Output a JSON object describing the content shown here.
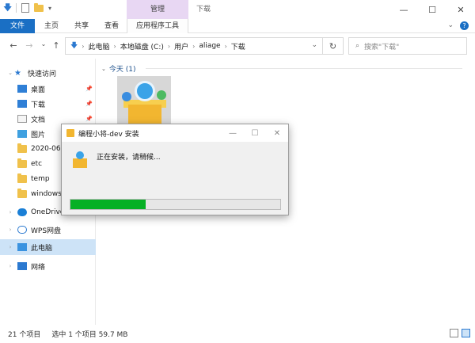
{
  "titlebar": {
    "context_tab": "管理",
    "window_title": "下载",
    "minimize": "—",
    "maximize": "☐",
    "close": "✕"
  },
  "ribbon": {
    "tabs": [
      "文件",
      "主页",
      "共享",
      "查看",
      "应用程序工具"
    ],
    "chevron": "⌄",
    "help": "?"
  },
  "nav": {
    "back": "←",
    "forward": "→",
    "recent": "⌄",
    "up": "↑",
    "breadcrumbs": [
      "此电脑",
      "本地磁盘 (C:)",
      "用户",
      "aliage",
      "下载"
    ],
    "refresh": "↻",
    "search_placeholder": "搜索\"下载\""
  },
  "sidebar": {
    "items": [
      {
        "label": "快速访问",
        "icon": "star-icon"
      },
      {
        "label": "桌面",
        "icon": "desktop-icon",
        "pinned": true
      },
      {
        "label": "下载",
        "icon": "download-icon",
        "pinned": true
      },
      {
        "label": "文档",
        "icon": "document-icon",
        "pinned": true
      },
      {
        "label": "图片",
        "icon": "picture-icon",
        "pinned": true
      },
      {
        "label": "2020-06",
        "icon": "folder-icon"
      },
      {
        "label": "etc",
        "icon": "folder-icon"
      },
      {
        "label": "temp",
        "icon": "folder-icon"
      },
      {
        "label": "windows",
        "icon": "folder-icon"
      },
      {
        "label": "OneDrive",
        "icon": "onedrive-icon"
      },
      {
        "label": "WPS网盘",
        "icon": "wps-cloud-icon"
      },
      {
        "label": "此电脑",
        "icon": "this-pc-icon",
        "selected": true
      },
      {
        "label": "网络",
        "icon": "network-icon"
      }
    ]
  },
  "content": {
    "group_header": "今天 (1)"
  },
  "dialog": {
    "title": "编程小将-dev 安装",
    "status": "正在安装，请稍候...",
    "progress": 0.36
  },
  "statusbar": {
    "item_count": "21 个项目",
    "selection": "选中 1 个项目  59.7 MB"
  },
  "colors": {
    "accent": "#1a6fc4",
    "progress_fill": "#06b025",
    "context_tab_bg": "#e8d7f3",
    "selected_bg": "#cde3f7"
  }
}
